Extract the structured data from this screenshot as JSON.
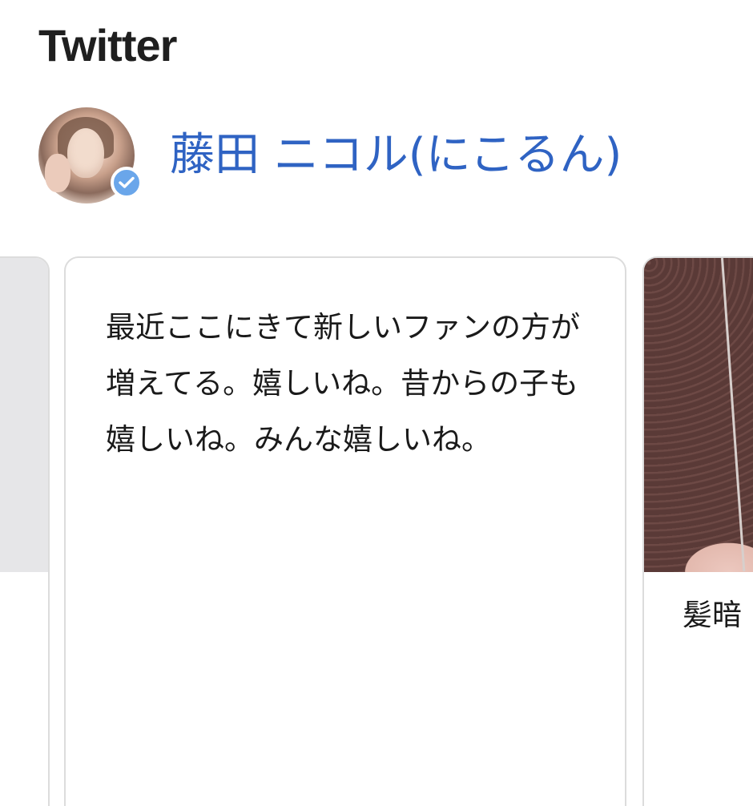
{
  "section": {
    "title": "Twitter"
  },
  "account": {
    "name": "藤田 ニコル(にこるん)",
    "avatar_icon": "profile-photo",
    "verified_icon": "verified-check-icon",
    "verified_color": "#6aa6ea",
    "link_color": "#2f63c3"
  },
  "carousel": {
    "current_tweet": {
      "text": "最近ここにきて新しいファンの方が増えてる。嬉しいね。昔からの子も嬉しいね。みんな嬉しいね。"
    },
    "next_tweet": {
      "text_visible": "髪暗"
    }
  }
}
